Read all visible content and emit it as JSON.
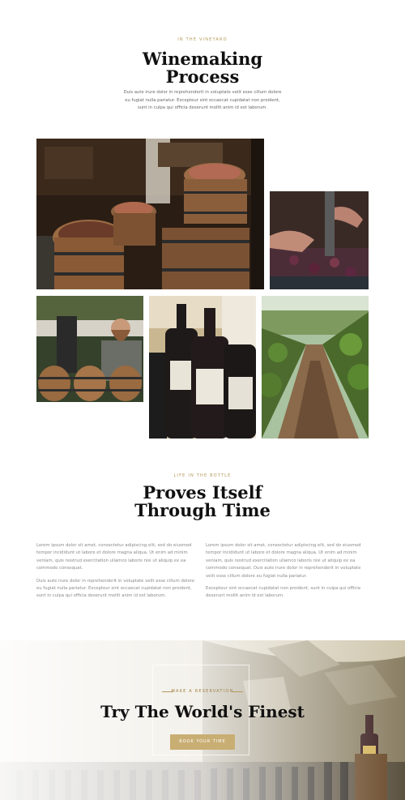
{
  "vineyard_section": {
    "eyebrow": "IN THE VINEYARD",
    "title_line1": "Winemaking",
    "title_line2": "Process",
    "lead_line1": "Duis aute irure dolor in reprehenderit in voluptate velit esse cillum dolore",
    "lead_line2": "eu fugiat nulla pariatur. Excepteur sint occaecat cupidatat non proident,",
    "lead_line3": "sunt in culpa qui officia deserunt mollit anim id est laborum."
  },
  "gallery": {
    "images": [
      {
        "subject": "wine-cellar-barrels-with-apples"
      },
      {
        "subject": "hands-pressing-grapes"
      },
      {
        "subject": "winemaker-with-barrels"
      },
      {
        "subject": "wine-bottles"
      },
      {
        "subject": "vineyard-rows"
      }
    ]
  },
  "bottle_section": {
    "eyebrow": "LIFE IN THE BOTTLE",
    "title_line1": "Proves Itself",
    "title_line2": "Through Time",
    "col1_p1": "Lorem ipsum dolor sit amet, consectetur adipiscing elit, sed do eiusmod tempor incididunt ut labore et dolore magna aliqua. Ut enim ad minim veniam, quis nostrud exercitation ullamco laboris nisi ut aliquip ex ea commodo consequat.",
    "col1_p2": "Duis aute irure dolor in reprehenderit in voluptate velit esse cillum dolore eu fugiat nulla pariatur. Excepteur sint occaecat cupidatat non proident, sunt in culpa qui officia deserunt mollit anim id est laborum.",
    "col2_p1": "Lorem ipsum dolor sit amet, consectetur adipiscing elit, sed do eiusmod tempor incididunt ut labore et dolore magna aliqua. Ut enim ad minim veniam, quis nostrud exercitation ullamco laboris nisi ut aliquip ex ea commodo consequat. Duis aute irure dolor in reprehenderit in voluptate velit esse cillum dolore eu fugiat nulla pariatur.",
    "col2_p2": "Excepteur sint occaecat cupidatat non proident, sunt in culpa qui officia deserunt mollit anim id est laborum."
  },
  "reservation_section": {
    "eyebrow": "MAKE A RESERVATION",
    "title": "Try The World's Finest",
    "button_label": "BOOK YOUR TIME"
  },
  "colors": {
    "accent_gold": "#c9ae73",
    "eyebrow_gold": "#b59a5a",
    "heading": "#111111",
    "body_text": "#888888"
  }
}
